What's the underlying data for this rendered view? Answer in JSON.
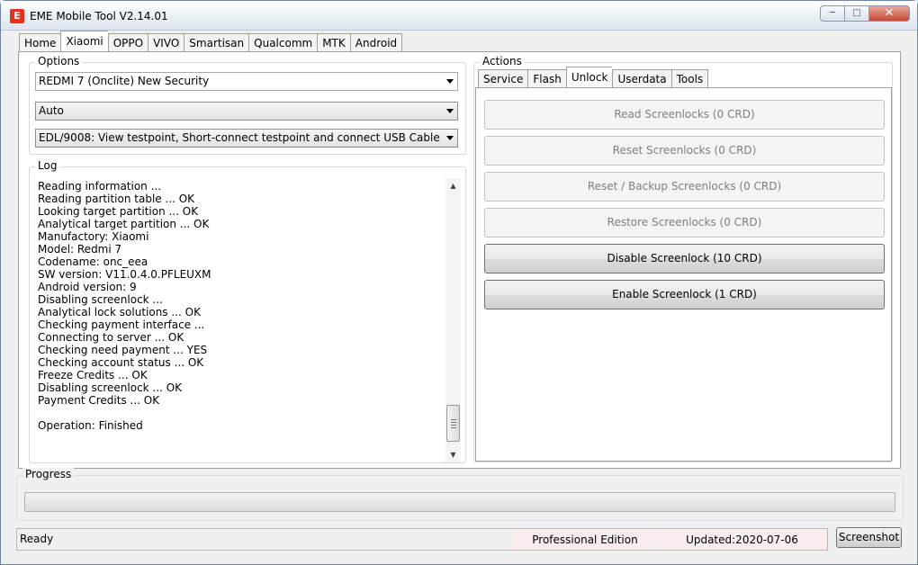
{
  "window": {
    "title": "EME Mobile Tool V2.14.01",
    "controls": [
      "minimize",
      "maximize",
      "close"
    ]
  },
  "main_tabs": [
    "Home",
    "Xiaomi",
    "OPPO",
    "VIVO",
    "Smartisan",
    "Qualcomm",
    "MTK",
    "Android"
  ],
  "main_tab_active": "Xiaomi",
  "options": {
    "title": "Options",
    "model": "REDMI 7 (Onclite) New Security",
    "mode": "Auto",
    "connection": "EDL/9008: View testpoint, Short-connect testpoint and connect USB Cable"
  },
  "log": {
    "title": "Log",
    "lines": [
      "Reading information ...",
      "Reading partition table ... OK",
      "Looking target partition ... OK",
      "Analytical target partition ... OK",
      "Manufactory: Xiaomi",
      "Model: Redmi 7",
      "Codename: onc_eea",
      "SW version: V11.0.4.0.PFLEUXM",
      "Android version: 9",
      "Disabling screenlock ...",
      "Analytical lock solutions ... OK",
      "Checking payment interface ...",
      "Connecting to server ... OK",
      "Checking need payment ... YES",
      "Checking account status ... OK",
      "Freeze Credits ... OK",
      "Disabling screenlock ... OK",
      "Payment Credits ... OK",
      "",
      "Operation: Finished"
    ]
  },
  "actions": {
    "title": "Actions",
    "tabs": [
      "Service",
      "Flash",
      "Unlock",
      "Userdata",
      "Tools"
    ],
    "active_tab": "Unlock",
    "buttons": [
      {
        "label": "Read Screenlocks (0 CRD)",
        "enabled": false
      },
      {
        "label": "Reset Screenlocks (0 CRD)",
        "enabled": false
      },
      {
        "label": "Reset / Backup Screenlocks (0 CRD)",
        "enabled": false
      },
      {
        "label": "Restore Screenlocks (0 CRD)",
        "enabled": false
      },
      {
        "label": "Disable Screenlock (10 CRD)",
        "enabled": true
      },
      {
        "label": "Enable Screenlock (1 CRD)",
        "enabled": true
      }
    ]
  },
  "progress": {
    "title": "Progress",
    "value": 0
  },
  "status": {
    "text": "Ready",
    "edition": "Professional Edition",
    "updated": "Updated:2020-07-06"
  },
  "screenshot_label": "Screenshot",
  "colors": {
    "progress_fill": "#06b025",
    "status_cell_bg": "#faeded"
  }
}
